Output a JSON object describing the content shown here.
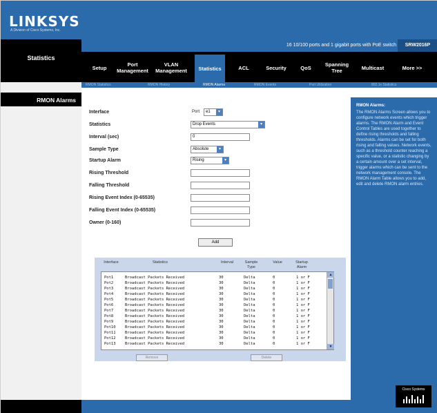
{
  "brand": {
    "name": "LINKSYS",
    "sub": "A Division of Cisco Systems, Inc."
  },
  "left": {
    "section": "Statistics",
    "subsection": "RMON Alarms"
  },
  "product": {
    "description": "16 10/100 ports and 1 gigabit ports with PoE switch",
    "model": "SRW2016P"
  },
  "nav": {
    "tabs": [
      {
        "label": "Setup"
      },
      {
        "label": "Port Management"
      },
      {
        "label": "VLAN Management"
      },
      {
        "label": "Statistics"
      },
      {
        "label": "ACL"
      },
      {
        "label": "Security"
      },
      {
        "label": "QoS"
      },
      {
        "label": "Spanning Tree"
      },
      {
        "label": "Multicast"
      },
      {
        "label": "More >>"
      }
    ],
    "subtabs": [
      {
        "label": "RMON Statistics"
      },
      {
        "label": "RMON History"
      },
      {
        "label": "RMON Alarms"
      },
      {
        "label": "RMON Events"
      },
      {
        "label": "Port Utilization"
      },
      {
        "label": "802.1x Statistics"
      }
    ]
  },
  "form": {
    "interface_label": "Interface",
    "interface_type": "Port",
    "interface_value": "e1",
    "statistics_label": "Statistics",
    "statistics_value": "Drop Events",
    "interval_label": "Interval (sec)",
    "interval_value": "0",
    "sample_type_label": "Sample Type",
    "sample_type_value": "Absolute",
    "startup_alarm_label": "Startup Alarm",
    "startup_alarm_value": "Rising",
    "rising_threshold_label": "Rising Threshold",
    "falling_threshold_label": "Falling Threshold",
    "rising_event_label": "Rising Event Index (0-65535)",
    "falling_event_label": "Falling Event Index (0-65535)",
    "owner_label": "Owner (0-160)",
    "add_button": "Add"
  },
  "table": {
    "headers": [
      "Interface",
      "Statistics",
      "Interval",
      "Sample Type",
      "Value",
      "Startup Alarm"
    ],
    "rows": [
      {
        "iface": "Pot1",
        "stat": "Broadcast Packets Received",
        "interval": "30",
        "sample": "Delta",
        "value": "0",
        "alarm": "1 or F"
      },
      {
        "iface": "Pot2",
        "stat": "Broadcast Packets Received",
        "interval": "30",
        "sample": "Delta",
        "value": "0",
        "alarm": "1 or F"
      },
      {
        "iface": "Pot3",
        "stat": "Broadcast Packets Received",
        "interval": "30",
        "sample": "Delta",
        "value": "0",
        "alarm": "1 or F"
      },
      {
        "iface": "Pot4",
        "stat": "Broadcast Packets Received",
        "interval": "30",
        "sample": "Delta",
        "value": "0",
        "alarm": "1 or F"
      },
      {
        "iface": "Pot5",
        "stat": "Broadcast Packets Received",
        "interval": "30",
        "sample": "Delta",
        "value": "0",
        "alarm": "1 or F"
      },
      {
        "iface": "Pot6",
        "stat": "Broadcast Packets Received",
        "interval": "30",
        "sample": "Delta",
        "value": "0",
        "alarm": "1 or F"
      },
      {
        "iface": "Pot7",
        "stat": "Broadcast Packets Received",
        "interval": "30",
        "sample": "Delta",
        "value": "0",
        "alarm": "1 or F"
      },
      {
        "iface": "Pot8",
        "stat": "Broadcast Packets Received",
        "interval": "30",
        "sample": "Delta",
        "value": "0",
        "alarm": "1 or F"
      },
      {
        "iface": "Pot9",
        "stat": "Broadcast Packets Received",
        "interval": "30",
        "sample": "Delta",
        "value": "0",
        "alarm": "1 or F"
      },
      {
        "iface": "Pot10",
        "stat": "Broadcast Packets Received",
        "interval": "30",
        "sample": "Delta",
        "value": "0",
        "alarm": "1 or F"
      },
      {
        "iface": "Pot11",
        "stat": "Broadcast Packets Received",
        "interval": "30",
        "sample": "Delta",
        "value": "0",
        "alarm": "1 or F"
      },
      {
        "iface": "Pot12",
        "stat": "Broadcast Packets Received",
        "interval": "30",
        "sample": "Delta",
        "value": "0",
        "alarm": "1 or F"
      },
      {
        "iface": "Pot13",
        "stat": "Broadcast Packets Received",
        "interval": "30",
        "sample": "Delta",
        "value": "0",
        "alarm": "1 or F"
      }
    ],
    "edit_button": "Remove",
    "delete_button": "Delete"
  },
  "help": {
    "title": "RMON Alarms:",
    "body": "The RMON Alarms Screen allows you to configure network events which trigger alarms. The RMON Alarm and Event Control Tables are used together to define rising thresholds and falling thresholds. Alarms can be set for both rising and falling values. Network events, such as a threshold counter reaching a specific value, or a statistic changing by a certain amount over a set interval, trigger alarms which can be sent to the network management console. The RMON Alarm Table allows you to add, edit and delete RMON alarm entries."
  },
  "footer": {
    "logo": "Cisco Systems"
  },
  "colors": {
    "primary_blue": "#2b6aab",
    "dark": "#000000",
    "table_bg": "#c9d6ec"
  }
}
